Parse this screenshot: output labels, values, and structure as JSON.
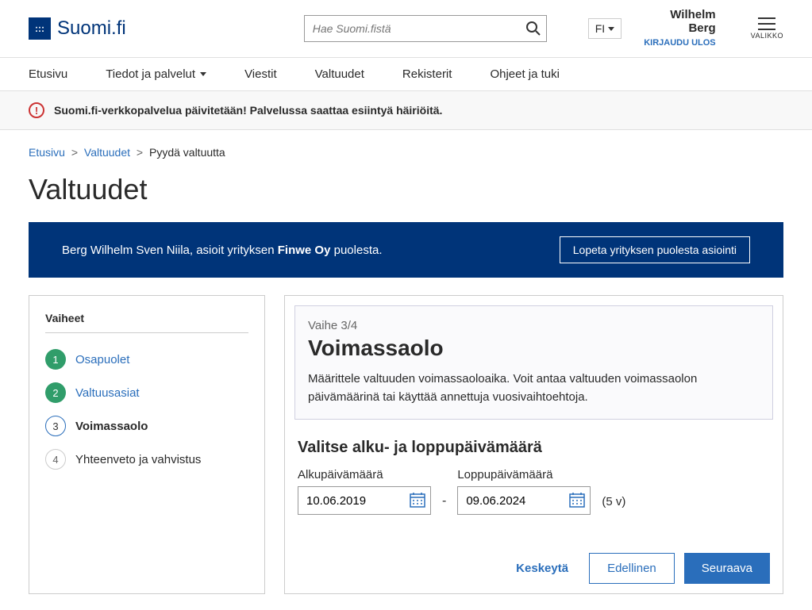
{
  "header": {
    "logo_text": "Suomi.fi",
    "search_placeholder": "Hae Suomi.fistä",
    "lang": "FI",
    "user_name": "Wilhelm Berg",
    "logout": "KIRJAUDU ULOS",
    "menu": "VALIKKO"
  },
  "nav": {
    "items": [
      "Etusivu",
      "Tiedot ja palvelut",
      "Viestit",
      "Valtuudet",
      "Rekisterit",
      "Ohjeet ja tuki"
    ]
  },
  "alert": {
    "text": "Suomi.fi-verkkopalvelua päivitetään! Palvelussa saattaa esiintyä häiriöitä."
  },
  "breadcrumb": {
    "items": [
      "Etusivu",
      "Valtuudet",
      "Pyydä valtuutta"
    ]
  },
  "page_title": "Valtuudet",
  "banner": {
    "prefix": "Berg Wilhelm Sven Niila, asioit yrityksen ",
    "company": "Finwe Oy",
    "suffix": " puolesta.",
    "button": "Lopeta yrityksen puolesta asiointi"
  },
  "steps": {
    "title": "Vaiheet",
    "items": [
      {
        "num": "1",
        "label": "Osapuolet",
        "state": "completed"
      },
      {
        "num": "2",
        "label": "Valtuusasiat",
        "state": "completed"
      },
      {
        "num": "3",
        "label": "Voimassaolo",
        "state": "active"
      },
      {
        "num": "4",
        "label": "Yhteenveto ja vahvistus",
        "state": "pending"
      }
    ]
  },
  "form": {
    "step_indicator": "Vaihe 3/4",
    "title": "Voimassaolo",
    "description": "Määrittele valtuuden voimassaoloaika. Voit antaa valtuuden voimassaolon päivämäärinä tai käyttää annettuja vuosivaihtoehtoja.",
    "section_title": "Valitse alku- ja loppupäivämäärä",
    "start_label": "Alkupäivämäärä",
    "start_value": "10.06.2019",
    "end_label": "Loppupäivämäärä",
    "end_value": "09.06.2024",
    "duration": "(5 v)",
    "cancel": "Keskeytä",
    "prev": "Edellinen",
    "next": "Seuraava"
  }
}
